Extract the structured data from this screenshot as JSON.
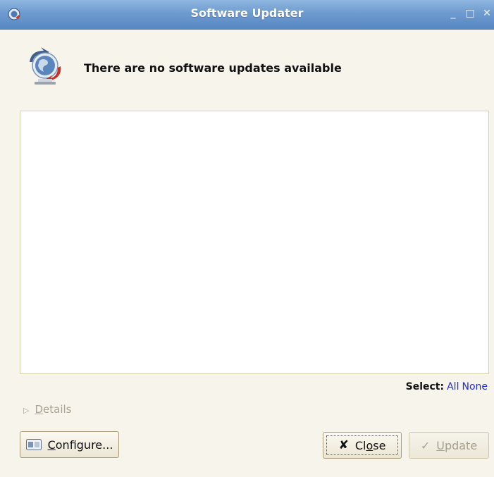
{
  "window": {
    "title": "Software Updater",
    "buttons": {
      "minimize": "_",
      "maximize": "□",
      "close": "✕"
    }
  },
  "header": {
    "message": "There are no software updates available",
    "icon": "globe-update-icon"
  },
  "update_list": {
    "items": []
  },
  "select": {
    "label": "Select:",
    "all": "All",
    "none": "None"
  },
  "details": {
    "label_first": "D",
    "label_rest": "etails"
  },
  "buttons": {
    "configure": {
      "mnemonic": "C",
      "rest": "onfigure..."
    },
    "close": {
      "pre": "Cl",
      "mnemonic": "o",
      "post": "se"
    },
    "update": {
      "mnemonic": "U",
      "rest": "pdate",
      "enabled": false
    }
  },
  "colors": {
    "titlebar": "#6e9bcf",
    "link": "#1f2ed6",
    "window_bg": "#f7f4ec"
  }
}
